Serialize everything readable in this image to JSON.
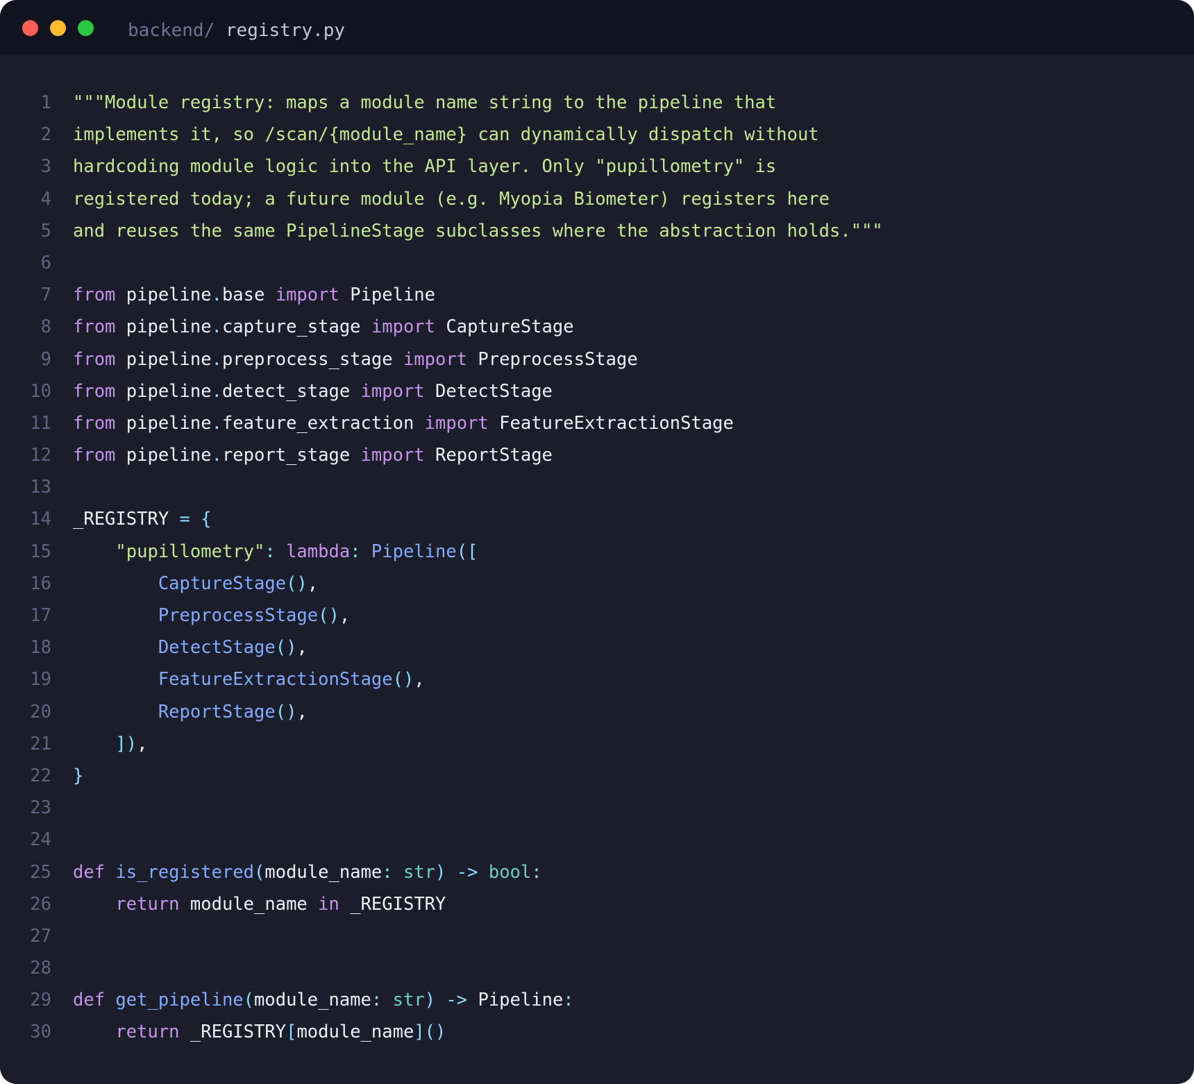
{
  "window": {
    "path_dir": "backend/ ",
    "file_name": "registry.py",
    "controls": [
      "close",
      "minimize",
      "maximize"
    ]
  },
  "colors": {
    "background": "#1b1d2b",
    "titlebar": "#111320",
    "string": "#c5e88f",
    "keyword": "#c792ea",
    "function": "#82aaff",
    "type": "#6fd0bd",
    "punctuation": "#89ddff",
    "identifier": "#eef0f8",
    "line_number": "#5f6580"
  },
  "code": {
    "lines": [
      {
        "n": "1",
        "tokens": [
          {
            "t": "\"\"\"Module registry: maps a module name string to the pipeline that",
            "c": "str"
          }
        ]
      },
      {
        "n": "2",
        "tokens": [
          {
            "t": "implements it, so /scan/{module_name} can dynamically dispatch without",
            "c": "str"
          }
        ]
      },
      {
        "n": "3",
        "tokens": [
          {
            "t": "hardcoding module logic into the API layer. Only \"pupillometry\" is",
            "c": "str"
          }
        ]
      },
      {
        "n": "4",
        "tokens": [
          {
            "t": "registered today; a future module (e.g. Myopia Biometer) registers here",
            "c": "str"
          }
        ]
      },
      {
        "n": "5",
        "tokens": [
          {
            "t": "and reuses the same PipelineStage subclasses where the abstraction holds.\"\"\"",
            "c": "str"
          }
        ]
      },
      {
        "n": "6",
        "tokens": []
      },
      {
        "n": "7",
        "tokens": [
          {
            "t": "from",
            "c": "kw"
          },
          {
            "t": " pipeline",
            "c": "id"
          },
          {
            "t": ".",
            "c": "punc"
          },
          {
            "t": "base ",
            "c": "id"
          },
          {
            "t": "import",
            "c": "kw"
          },
          {
            "t": " Pipeline",
            "c": "id"
          }
        ]
      },
      {
        "n": "8",
        "tokens": [
          {
            "t": "from",
            "c": "kw"
          },
          {
            "t": " pipeline",
            "c": "id"
          },
          {
            "t": ".",
            "c": "punc"
          },
          {
            "t": "capture_stage ",
            "c": "id"
          },
          {
            "t": "import",
            "c": "kw"
          },
          {
            "t": " CaptureStage",
            "c": "id"
          }
        ]
      },
      {
        "n": "9",
        "tokens": [
          {
            "t": "from",
            "c": "kw"
          },
          {
            "t": " pipeline",
            "c": "id"
          },
          {
            "t": ".",
            "c": "punc"
          },
          {
            "t": "preprocess_stage ",
            "c": "id"
          },
          {
            "t": "import",
            "c": "kw"
          },
          {
            "t": " PreprocessStage",
            "c": "id"
          }
        ]
      },
      {
        "n": "10",
        "tokens": [
          {
            "t": "from",
            "c": "kw"
          },
          {
            "t": " pipeline",
            "c": "id"
          },
          {
            "t": ".",
            "c": "punc"
          },
          {
            "t": "detect_stage ",
            "c": "id"
          },
          {
            "t": "import",
            "c": "kw"
          },
          {
            "t": " DetectStage",
            "c": "id"
          }
        ]
      },
      {
        "n": "11",
        "tokens": [
          {
            "t": "from",
            "c": "kw"
          },
          {
            "t": " pipeline",
            "c": "id"
          },
          {
            "t": ".",
            "c": "punc"
          },
          {
            "t": "feature_extraction ",
            "c": "id"
          },
          {
            "t": "import",
            "c": "kw"
          },
          {
            "t": " FeatureExtractionStage",
            "c": "id"
          }
        ]
      },
      {
        "n": "12",
        "tokens": [
          {
            "t": "from",
            "c": "kw"
          },
          {
            "t": " pipeline",
            "c": "id"
          },
          {
            "t": ".",
            "c": "punc"
          },
          {
            "t": "report_stage ",
            "c": "id"
          },
          {
            "t": "import",
            "c": "kw"
          },
          {
            "t": " ReportStage",
            "c": "id"
          }
        ]
      },
      {
        "n": "13",
        "tokens": []
      },
      {
        "n": "14",
        "tokens": [
          {
            "t": "_REGISTRY ",
            "c": "id"
          },
          {
            "t": "=",
            "c": "punc"
          },
          {
            "t": " ",
            "c": "id"
          },
          {
            "t": "{",
            "c": "punc"
          }
        ]
      },
      {
        "n": "15",
        "tokens": [
          {
            "t": "    ",
            "c": "id"
          },
          {
            "t": "\"pupillometry\"",
            "c": "str"
          },
          {
            "t": ":",
            "c": "punc"
          },
          {
            "t": " ",
            "c": "id"
          },
          {
            "t": "lambda",
            "c": "kw"
          },
          {
            "t": ":",
            "c": "punc"
          },
          {
            "t": " ",
            "c": "id"
          },
          {
            "t": "Pipeline",
            "c": "fn"
          },
          {
            "t": "([",
            "c": "punc"
          }
        ]
      },
      {
        "n": "16",
        "tokens": [
          {
            "t": "        ",
            "c": "id"
          },
          {
            "t": "CaptureStage",
            "c": "fn"
          },
          {
            "t": "()",
            "c": "punc"
          },
          {
            "t": ",",
            "c": "id"
          }
        ]
      },
      {
        "n": "17",
        "tokens": [
          {
            "t": "        ",
            "c": "id"
          },
          {
            "t": "PreprocessStage",
            "c": "fn"
          },
          {
            "t": "()",
            "c": "punc"
          },
          {
            "t": ",",
            "c": "id"
          }
        ]
      },
      {
        "n": "18",
        "tokens": [
          {
            "t": "        ",
            "c": "id"
          },
          {
            "t": "DetectStage",
            "c": "fn"
          },
          {
            "t": "()",
            "c": "punc"
          },
          {
            "t": ",",
            "c": "id"
          }
        ]
      },
      {
        "n": "19",
        "tokens": [
          {
            "t": "        ",
            "c": "id"
          },
          {
            "t": "FeatureExtractionStage",
            "c": "fn"
          },
          {
            "t": "()",
            "c": "punc"
          },
          {
            "t": ",",
            "c": "id"
          }
        ]
      },
      {
        "n": "20",
        "tokens": [
          {
            "t": "        ",
            "c": "id"
          },
          {
            "t": "ReportStage",
            "c": "fn"
          },
          {
            "t": "()",
            "c": "punc"
          },
          {
            "t": ",",
            "c": "id"
          }
        ]
      },
      {
        "n": "21",
        "tokens": [
          {
            "t": "    ",
            "c": "id"
          },
          {
            "t": "])",
            "c": "punc"
          },
          {
            "t": ",",
            "c": "id"
          }
        ]
      },
      {
        "n": "22",
        "tokens": [
          {
            "t": "}",
            "c": "punc"
          }
        ]
      },
      {
        "n": "23",
        "tokens": []
      },
      {
        "n": "24",
        "tokens": []
      },
      {
        "n": "25",
        "tokens": [
          {
            "t": "def",
            "c": "kw"
          },
          {
            "t": " ",
            "c": "id"
          },
          {
            "t": "is_registered",
            "c": "fn"
          },
          {
            "t": "(",
            "c": "punc"
          },
          {
            "t": "module_name",
            "c": "id"
          },
          {
            "t": ":",
            "c": "punc"
          },
          {
            "t": " ",
            "c": "id"
          },
          {
            "t": "str",
            "c": "type"
          },
          {
            "t": ")",
            "c": "punc"
          },
          {
            "t": " ",
            "c": "id"
          },
          {
            "t": "->",
            "c": "punc"
          },
          {
            "t": " ",
            "c": "id"
          },
          {
            "t": "bool",
            "c": "type"
          },
          {
            "t": ":",
            "c": "punc"
          }
        ]
      },
      {
        "n": "26",
        "tokens": [
          {
            "t": "    ",
            "c": "id"
          },
          {
            "t": "return",
            "c": "kw"
          },
          {
            "t": " module_name ",
            "c": "id"
          },
          {
            "t": "in",
            "c": "kw"
          },
          {
            "t": " _REGISTRY",
            "c": "id"
          }
        ]
      },
      {
        "n": "27",
        "tokens": []
      },
      {
        "n": "28",
        "tokens": []
      },
      {
        "n": "29",
        "tokens": [
          {
            "t": "def",
            "c": "kw"
          },
          {
            "t": " ",
            "c": "id"
          },
          {
            "t": "get_pipeline",
            "c": "fn"
          },
          {
            "t": "(",
            "c": "punc"
          },
          {
            "t": "module_name",
            "c": "id"
          },
          {
            "t": ":",
            "c": "punc"
          },
          {
            "t": " ",
            "c": "id"
          },
          {
            "t": "str",
            "c": "type"
          },
          {
            "t": ")",
            "c": "punc"
          },
          {
            "t": " ",
            "c": "id"
          },
          {
            "t": "->",
            "c": "punc"
          },
          {
            "t": " Pipeline",
            "c": "id"
          },
          {
            "t": ":",
            "c": "punc"
          }
        ]
      },
      {
        "n": "30",
        "tokens": [
          {
            "t": "    ",
            "c": "id"
          },
          {
            "t": "return",
            "c": "kw"
          },
          {
            "t": " _REGISTRY",
            "c": "id"
          },
          {
            "t": "[",
            "c": "punc"
          },
          {
            "t": "module_name",
            "c": "id"
          },
          {
            "t": "]()",
            "c": "punc"
          }
        ]
      }
    ]
  }
}
